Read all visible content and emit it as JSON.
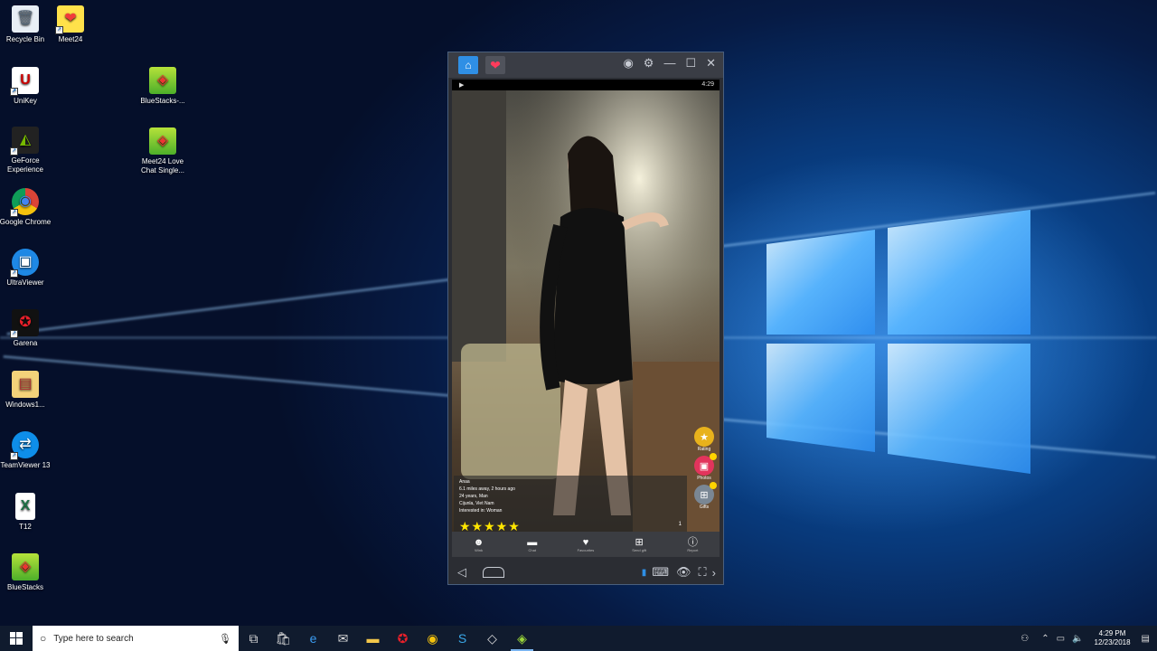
{
  "desktop": {
    "icons": [
      {
        "label": "Recycle Bin",
        "icon": "recycle-bin-icon",
        "glyph": "🗑"
      },
      {
        "label": "Meet24",
        "icon": "meet24-icon",
        "glyph": "❤"
      },
      {
        "label": "UniKey",
        "icon": "unikey-icon",
        "glyph": "U"
      },
      {
        "label": "BlueStacks-...",
        "icon": "bluestacks-installer-icon",
        "glyph": "◈"
      },
      {
        "label": "GeForce Experience",
        "icon": "geforce-icon",
        "glyph": "◭"
      },
      {
        "label": "Meet24 Love Chat Single...",
        "icon": "meet24-bluestacks-icon",
        "glyph": "◈"
      },
      {
        "label": "Google Chrome",
        "icon": "chrome-icon",
        "glyph": "◉"
      },
      {
        "label": "UltraViewer",
        "icon": "ultraviewer-icon",
        "glyph": "▣"
      },
      {
        "label": "Garena",
        "icon": "garena-icon",
        "glyph": "✪"
      },
      {
        "label": "Windows1...",
        "icon": "windows-folder-icon",
        "glyph": "▤"
      },
      {
        "label": "TeamViewer 13",
        "icon": "teamviewer-icon",
        "glyph": "⇄"
      },
      {
        "label": "T12",
        "icon": "excel-file-icon",
        "glyph": "X"
      },
      {
        "label": "BlueStacks",
        "icon": "bluestacks-icon",
        "glyph": "◈"
      }
    ]
  },
  "bluestacks": {
    "title_icons": [
      "home-tab-icon",
      "meet24-tab-icon"
    ],
    "controls": [
      "account-icon",
      "settings-icon",
      "minimize-icon",
      "maximize-icon",
      "close-icon"
    ],
    "status_time": "4:29",
    "profile": {
      "name": "Anaa",
      "line1": "6.1 miles away, 2 hours ago",
      "line2": "24 years, Man",
      "line3": "Cijunla, Viet Nam",
      "line4": "Interested in: Woman",
      "rating_stars": 5,
      "stars_text": "★★★★★",
      "page": "1"
    },
    "side_buttons": [
      {
        "label": "Rating",
        "icon": "star-icon"
      },
      {
        "label": "Photos",
        "icon": "photos-icon"
      },
      {
        "label": "Gifts",
        "icon": "gift-icon"
      }
    ],
    "nav": [
      {
        "label": "Wink",
        "icon": "wink-icon",
        "glyph": "☻"
      },
      {
        "label": "Chat",
        "icon": "chat-icon",
        "glyph": "▬"
      },
      {
        "label": "Favourites",
        "icon": "heart-icon",
        "glyph": "♥"
      },
      {
        "label": "Send gift",
        "icon": "send-gift-icon",
        "glyph": "⊞"
      },
      {
        "label": "Report",
        "icon": "report-icon",
        "glyph": "ⓘ"
      }
    ]
  },
  "taskbar": {
    "search_placeholder": "Type here to search",
    "time": "4:29 PM",
    "date": "12/23/2018"
  }
}
